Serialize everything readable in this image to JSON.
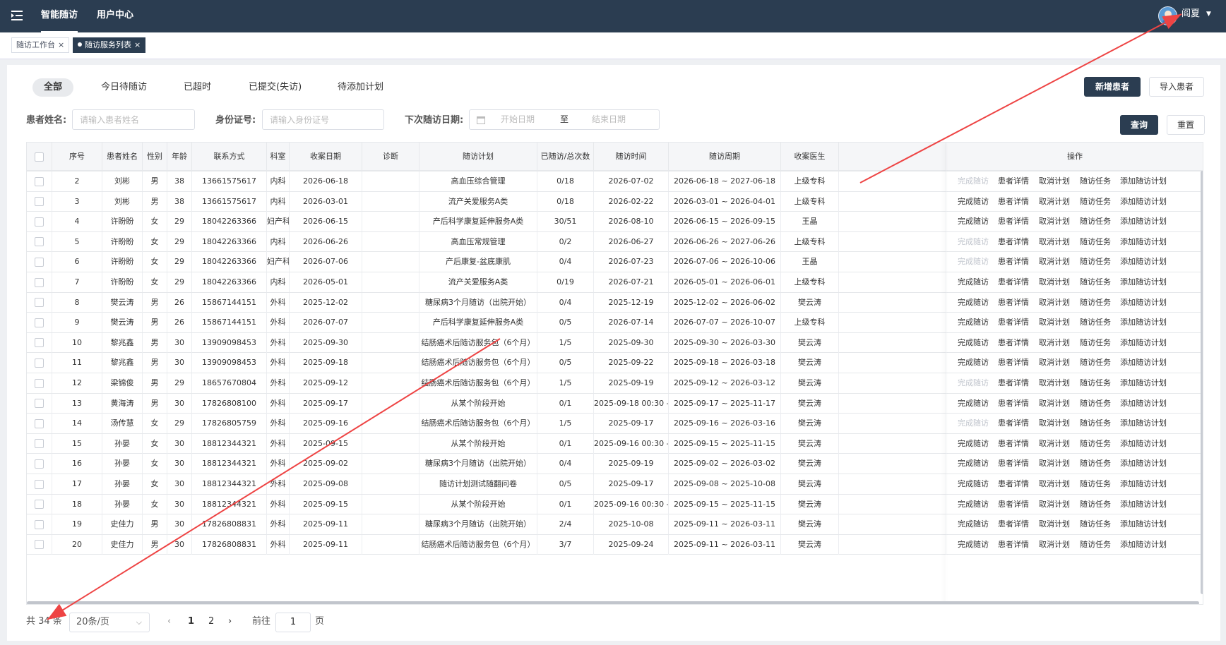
{
  "topbar": {
    "nav": [
      "智能随访",
      "用户中心"
    ],
    "user": "阎夏"
  },
  "tags": [
    {
      "label": "随访工作台"
    },
    {
      "label": "随访服务列表"
    }
  ],
  "status_tabs": [
    "全部",
    "今日待随访",
    "已超时",
    "已提交(失访)",
    "待添加计划"
  ],
  "buttons": {
    "add_patient": "新增患者",
    "import_patient": "导入患者",
    "query": "查询",
    "reset": "重置"
  },
  "filters": {
    "name_label": "患者姓名:",
    "name_placeholder": "请输入患者姓名",
    "id_label": "身份证号:",
    "id_placeholder": "请输入身份证号",
    "date_label": "下次随访日期:",
    "start_placeholder": "开始日期",
    "to": "至",
    "end_placeholder": "结束日期"
  },
  "columns": [
    "序号",
    "患者姓名",
    "性别",
    "年龄",
    "联系方式",
    "科室",
    "收案日期",
    "诊断",
    "随访计划",
    "已随访/总次数",
    "随访时间",
    "随访周期",
    "收案医生",
    "操作"
  ],
  "actions": [
    "完成随访",
    "患者详情",
    "取消计划",
    "随访任务",
    "添加随访计划"
  ],
  "rows": [
    {
      "no": "2",
      "name": "刘彬",
      "sex": "男",
      "age": "38",
      "phone": "13661575617",
      "dept": "内科",
      "date": "2026-06-18",
      "diag": "",
      "plan": "高血压综合管理",
      "count": "0/18",
      "time": "2026-07-02",
      "period": "2026-06-18 ~ 2027-06-18",
      "doctor": "上级专科",
      "done_disabled": true
    },
    {
      "no": "3",
      "name": "刘彬",
      "sex": "男",
      "age": "38",
      "phone": "13661575617",
      "dept": "内科",
      "date": "2026-03-01",
      "diag": "",
      "plan": "流产关爱服务A类",
      "count": "0/18",
      "time": "2026-02-22",
      "period": "2026-03-01 ~ 2026-04-01",
      "doctor": "上级专科",
      "done_disabled": false
    },
    {
      "no": "4",
      "name": "许盼盼",
      "sex": "女",
      "age": "29",
      "phone": "18042263366",
      "dept": "妇产科",
      "date": "2026-06-15",
      "diag": "",
      "plan": "产后科学康复延伸服务A类",
      "count": "30/51",
      "time": "2026-08-10",
      "period": "2026-06-15 ~ 2026-09-15",
      "doctor": "王晶",
      "done_disabled": false
    },
    {
      "no": "5",
      "name": "许盼盼",
      "sex": "女",
      "age": "29",
      "phone": "18042263366",
      "dept": "内科",
      "date": "2026-06-26",
      "diag": "",
      "plan": "高血压常规管理",
      "count": "0/2",
      "time": "2026-06-27",
      "period": "2026-06-26 ~ 2027-06-26",
      "doctor": "上级专科",
      "done_disabled": true
    },
    {
      "no": "6",
      "name": "许盼盼",
      "sex": "女",
      "age": "29",
      "phone": "18042263366",
      "dept": "妇产科",
      "date": "2026-07-06",
      "diag": "",
      "plan": "产后康复-盆底康肌",
      "count": "0/4",
      "time": "2026-07-23",
      "period": "2026-07-06 ~ 2026-10-06",
      "doctor": "王晶",
      "done_disabled": true
    },
    {
      "no": "7",
      "name": "许盼盼",
      "sex": "女",
      "age": "29",
      "phone": "18042263366",
      "dept": "内科",
      "date": "2026-05-01",
      "diag": "",
      "plan": "流产关爱服务A类",
      "count": "0/19",
      "time": "2026-07-21",
      "period": "2026-05-01 ~ 2026-06-01",
      "doctor": "上级专科",
      "done_disabled": false
    },
    {
      "no": "8",
      "name": "樊云涛",
      "sex": "男",
      "age": "26",
      "phone": "15867144151",
      "dept": "外科",
      "date": "2025-12-02",
      "diag": "",
      "plan": "糖尿病3个月随访（出院开始）",
      "count": "0/4",
      "time": "2025-12-19",
      "period": "2025-12-02 ~ 2026-06-02",
      "doctor": "樊云涛",
      "done_disabled": false
    },
    {
      "no": "9",
      "name": "樊云涛",
      "sex": "男",
      "age": "26",
      "phone": "15867144151",
      "dept": "外科",
      "date": "2026-07-07",
      "diag": "",
      "plan": "产后科学康复延伸服务A类",
      "count": "0/5",
      "time": "2026-07-14",
      "period": "2026-07-07 ~ 2026-10-07",
      "doctor": "上级专科",
      "done_disabled": false
    },
    {
      "no": "10",
      "name": "黎兆鑫",
      "sex": "男",
      "age": "30",
      "phone": "13909098453",
      "dept": "外科",
      "date": "2025-09-30",
      "diag": "",
      "plan": "结肠癌术后随访服务包（6个月）",
      "count": "1/5",
      "time": "2025-09-30",
      "period": "2025-09-30 ~ 2026-03-30",
      "doctor": "樊云涛",
      "done_disabled": false
    },
    {
      "no": "11",
      "name": "黎兆鑫",
      "sex": "男",
      "age": "30",
      "phone": "13909098453",
      "dept": "外科",
      "date": "2025-09-18",
      "diag": "",
      "plan": "结肠癌术后随访服务包（6个月）",
      "count": "0/5",
      "time": "2025-09-22",
      "period": "2025-09-18 ~ 2026-03-18",
      "doctor": "樊云涛",
      "done_disabled": false
    },
    {
      "no": "12",
      "name": "梁锦俊",
      "sex": "男",
      "age": "29",
      "phone": "18657670804",
      "dept": "外科",
      "date": "2025-09-12",
      "diag": "",
      "plan": "结肠癌术后随访服务包（6个月）",
      "count": "1/5",
      "time": "2025-09-19",
      "period": "2025-09-12 ~ 2026-03-12",
      "doctor": "樊云涛",
      "done_disabled": true
    },
    {
      "no": "13",
      "name": "黄海涛",
      "sex": "男",
      "age": "30",
      "phone": "17826808100",
      "dept": "外科",
      "date": "2025-09-17",
      "diag": "",
      "plan": "从某个阶段开始",
      "count": "0/1",
      "time": "2025-09-18 00:30 - (",
      "period": "2025-09-17 ~ 2025-11-17",
      "doctor": "樊云涛",
      "done_disabled": false
    },
    {
      "no": "14",
      "name": "汤传慧",
      "sex": "女",
      "age": "29",
      "phone": "17826805759",
      "dept": "外科",
      "date": "2025-09-16",
      "diag": "",
      "plan": "结肠癌术后随访服务包（6个月）",
      "count": "1/5",
      "time": "2025-09-17",
      "period": "2025-09-16 ~ 2026-03-16",
      "doctor": "樊云涛",
      "done_disabled": true
    },
    {
      "no": "15",
      "name": "孙晏",
      "sex": "女",
      "age": "30",
      "phone": "18812344321",
      "dept": "外科",
      "date": "2025-09-15",
      "diag": "",
      "plan": "从某个阶段开始",
      "count": "0/1",
      "time": "2025-09-16 00:30 - (",
      "period": "2025-09-15 ~ 2025-11-15",
      "doctor": "樊云涛",
      "done_disabled": false
    },
    {
      "no": "16",
      "name": "孙晏",
      "sex": "女",
      "age": "30",
      "phone": "18812344321",
      "dept": "外科",
      "date": "2025-09-02",
      "diag": "",
      "plan": "糖尿病3个月随访（出院开始）",
      "count": "0/4",
      "time": "2025-09-19",
      "period": "2025-09-02 ~ 2026-03-02",
      "doctor": "樊云涛",
      "done_disabled": false
    },
    {
      "no": "17",
      "name": "孙晏",
      "sex": "女",
      "age": "30",
      "phone": "18812344321",
      "dept": "外科",
      "date": "2025-09-08",
      "diag": "",
      "plan": "随访计划测试随翻问卷",
      "count": "0/5",
      "time": "2025-09-17",
      "period": "2025-09-08 ~ 2025-10-08",
      "doctor": "樊云涛",
      "done_disabled": false
    },
    {
      "no": "18",
      "name": "孙晏",
      "sex": "女",
      "age": "30",
      "phone": "18812344321",
      "dept": "外科",
      "date": "2025-09-15",
      "diag": "",
      "plan": "从某个阶段开始",
      "count": "0/1",
      "time": "2025-09-16 00:30 - (",
      "period": "2025-09-15 ~ 2025-11-15",
      "doctor": "樊云涛",
      "done_disabled": false
    },
    {
      "no": "19",
      "name": "史佳力",
      "sex": "男",
      "age": "30",
      "phone": "17826808831",
      "dept": "外科",
      "date": "2025-09-11",
      "diag": "",
      "plan": "糖尿病3个月随访（出院开始）",
      "count": "2/4",
      "time": "2025-10-08",
      "period": "2025-09-11 ~ 2026-03-11",
      "doctor": "樊云涛",
      "done_disabled": false
    },
    {
      "no": "20",
      "name": "史佳力",
      "sex": "男",
      "age": "30",
      "phone": "17826808831",
      "dept": "外科",
      "date": "2025-09-11",
      "diag": "",
      "plan": "结肠癌术后随访服务包（6个月）",
      "count": "3/7",
      "time": "2025-09-24",
      "period": "2025-09-11 ~ 2026-03-11",
      "doctor": "樊云涛",
      "done_disabled": false
    }
  ],
  "pagination": {
    "total_text": "共 34 条",
    "page_size": "20条/页",
    "pages": [
      "1",
      "2"
    ],
    "current_page": "1",
    "goto_prefix": "前往",
    "goto_value": "1",
    "goto_suffix": "页"
  },
  "colors": {
    "header_bg": "#2b3d51",
    "annotation_arrow": "#ee4444"
  }
}
